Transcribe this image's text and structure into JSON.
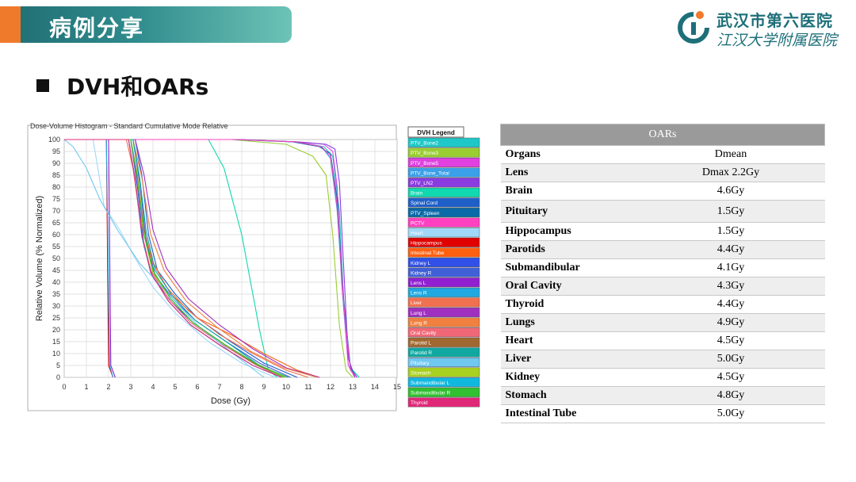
{
  "slide": {
    "banner_title": "病例分享",
    "logo_line1": "武汉市第六医院",
    "logo_line2": "江汉大学附属医院",
    "heading": "DVH和OARs"
  },
  "colors": {
    "banner_dark": "#1f6d72",
    "banner_light": "#6cc3b6",
    "accent_orange": "#f07a2b",
    "table_header": "#9a9a9a"
  },
  "icons": {
    "logo": "hospital-emblem-icon",
    "bullet": "square-bullet-icon"
  },
  "chart_data": {
    "type": "line",
    "title": "Dose-Volume Histogram - Standard Cumulative Mode Relative",
    "xlabel": "Dose (Gy)",
    "ylabel": "Relative Volume (% Normalized)",
    "xlim": [
      0,
      15
    ],
    "ylim": [
      0,
      100
    ],
    "xticks": [
      "0",
      "1",
      "2",
      "3",
      "4",
      "5",
      "6",
      "7",
      "8",
      "9",
      "10",
      "11",
      "12",
      "13",
      "14",
      "15"
    ],
    "yticks": [
      "0",
      "5",
      "10",
      "15",
      "20",
      "25",
      "30",
      "35",
      "40",
      "45",
      "50",
      "55",
      "60",
      "65",
      "70",
      "75",
      "80",
      "85",
      "90",
      "95",
      "100"
    ],
    "grid": true,
    "legend_title": "DVH Legend",
    "legend_position": "right",
    "series": [
      {
        "name": "PTV_Bone2",
        "color": "#1ec8c8",
        "x": [
          0,
          7.8,
          10.5,
          11.7,
          12.1,
          12.4,
          12.6,
          12.9,
          13.3
        ],
        "y": [
          100,
          100,
          99,
          97,
          93,
          70,
          30,
          4,
          0
        ]
      },
      {
        "name": "PTV_Bone3",
        "color": "#9acd32",
        "x": [
          0,
          7.5,
          10,
          11.2,
          11.8,
          12.1,
          12.4,
          12.7,
          13.0
        ],
        "y": [
          100,
          100,
          98,
          93,
          85,
          60,
          22,
          3,
          0
        ]
      },
      {
        "name": "PTV_Bone5",
        "color": "#e040e0",
        "x": [
          0,
          7.8,
          10.5,
          11.7,
          12.1,
          12.3,
          12.5,
          12.8,
          13.1
        ],
        "y": [
          100,
          100,
          99,
          98,
          95,
          80,
          40,
          5,
          0
        ]
      },
      {
        "name": "PTV_Bone_Total",
        "color": "#3aa0e8",
        "x": [
          0,
          7.6,
          10.5,
          11.6,
          12.0,
          12.3,
          12.6,
          12.9,
          13.2
        ],
        "y": [
          100,
          100,
          99,
          97,
          92,
          70,
          28,
          3,
          0
        ]
      },
      {
        "name": "PTV_LN2",
        "color": "#8a3ce0",
        "x": [
          0,
          7.9,
          10.6,
          11.8,
          12.2,
          12.4,
          12.6,
          12.8,
          13.1
        ],
        "y": [
          100,
          100,
          99,
          98,
          96,
          82,
          45,
          8,
          0
        ]
      },
      {
        "name": "Brain",
        "color": "#10d8b0",
        "x": [
          0,
          6.5,
          7.2,
          8.0,
          8.8,
          9.2,
          9.6
        ],
        "y": [
          100,
          100,
          88,
          60,
          20,
          3,
          0
        ]
      },
      {
        "name": "Spinal Cord",
        "color": "#1f5fc8",
        "x": [
          0,
          3.2,
          3.5,
          3.8,
          4.2,
          5.0,
          6.0,
          7.5,
          9.0,
          10.5
        ],
        "y": [
          100,
          100,
          85,
          60,
          45,
          35,
          25,
          15,
          6,
          0
        ]
      },
      {
        "name": "PTV_Spleen",
        "color": "#0a6aa8",
        "x": [
          0,
          7.6,
          10.3,
          11.5,
          12.0,
          12.3,
          12.6,
          12.9,
          13.2
        ],
        "y": [
          100,
          100,
          99,
          97,
          94,
          75,
          32,
          4,
          0
        ]
      },
      {
        "name": "PCTV",
        "color": "#ff40c0",
        "x": [
          0,
          7.7,
          10.5,
          11.6,
          12.0,
          12.3,
          12.6,
          12.9,
          13.2
        ],
        "y": [
          100,
          100,
          99,
          97,
          93,
          72,
          30,
          3,
          0
        ]
      },
      {
        "name": "Heart",
        "color": "#a0d8f8",
        "x": [
          0,
          1.3,
          1.8,
          2.5,
          3.2,
          4.0,
          5.0,
          6.5,
          8.0,
          9.5
        ],
        "y": [
          100,
          100,
          72,
          62,
          50,
          38,
          27,
          15,
          6,
          0
        ]
      },
      {
        "name": "Hippocampus",
        "color": "#e00000",
        "x": [
          0,
          1.9,
          2.0,
          2.2
        ],
        "y": [
          100,
          100,
          5,
          0
        ]
      },
      {
        "name": "Intestinal Tube",
        "color": "#ff6010",
        "x": [
          0,
          3.0,
          3.3,
          3.6,
          4.0,
          4.8,
          6.0,
          7.5,
          9.0,
          10.5,
          11.5
        ],
        "y": [
          100,
          100,
          85,
          62,
          48,
          35,
          25,
          18,
          10,
          3,
          0
        ]
      },
      {
        "name": "Kidney L",
        "color": "#3050e8",
        "x": [
          0,
          3.0,
          3.3,
          3.6,
          4.0,
          4.8,
          5.8,
          7.2,
          8.6,
          10.0
        ],
        "y": [
          100,
          100,
          80,
          55,
          42,
          32,
          23,
          14,
          6,
          0
        ]
      },
      {
        "name": "Kidney R",
        "color": "#4060d8",
        "x": [
          0,
          3.1,
          3.4,
          3.7,
          4.1,
          4.9,
          5.9,
          7.3,
          8.8,
          10.2
        ],
        "y": [
          100,
          100,
          82,
          57,
          43,
          33,
          24,
          15,
          6,
          0
        ]
      },
      {
        "name": "Lens L",
        "color": "#9020d0",
        "x": [
          0,
          2.0,
          2.1,
          2.3
        ],
        "y": [
          100,
          100,
          5,
          0
        ]
      },
      {
        "name": "Lens R",
        "color": "#20a8e0",
        "x": [
          0,
          1.9,
          2.05,
          2.2
        ],
        "y": [
          100,
          100,
          5,
          0
        ]
      },
      {
        "name": "Liver",
        "color": "#f07050",
        "x": [
          0,
          2.8,
          3.1,
          3.4,
          3.8,
          4.6,
          5.6,
          7.0,
          8.5,
          10.0,
          11.0
        ],
        "y": [
          100,
          100,
          88,
          68,
          52,
          38,
          28,
          18,
          10,
          3,
          0
        ]
      },
      {
        "name": "Lung L",
        "color": "#a030c0",
        "x": [
          0,
          3.2,
          3.6,
          4.0,
          4.6,
          5.6,
          7.0,
          8.5,
          10.0,
          11.5
        ],
        "y": [
          100,
          100,
          85,
          62,
          46,
          33,
          22,
          12,
          4,
          0
        ]
      },
      {
        "name": "Lung R",
        "color": "#f08040",
        "x": [
          0,
          3.1,
          3.5,
          3.9,
          4.5,
          5.5,
          6.9,
          8.4,
          9.9,
          11.4
        ],
        "y": [
          100,
          100,
          84,
          60,
          45,
          32,
          21,
          11,
          4,
          0
        ]
      },
      {
        "name": "Oral Cavity",
        "color": "#f06878",
        "x": [
          0,
          2.9,
          3.2,
          3.5,
          3.9,
          4.7,
          5.7,
          7.1,
          8.5,
          9.8
        ],
        "y": [
          100,
          100,
          82,
          60,
          45,
          33,
          23,
          14,
          6,
          0
        ]
      },
      {
        "name": "Parotid L",
        "color": "#a06830",
        "x": [
          0,
          3.0,
          3.3,
          3.6,
          4.0,
          4.8,
          5.8,
          7.2,
          8.7,
          10.0
        ],
        "y": [
          100,
          100,
          83,
          60,
          44,
          33,
          23,
          14,
          5,
          0
        ]
      },
      {
        "name": "Parotid R",
        "color": "#10a8a0",
        "x": [
          0,
          3.1,
          3.4,
          3.7,
          4.1,
          4.9,
          5.9,
          7.3,
          8.8,
          10.1
        ],
        "y": [
          100,
          100,
          84,
          61,
          45,
          34,
          24,
          15,
          5,
          0
        ]
      },
      {
        "name": "Pituitary",
        "color": "#70c8f0",
        "x": [
          0,
          0.4,
          1.0,
          1.6,
          2.4,
          3.4,
          4.6,
          6.0,
          7.6,
          9.0
        ],
        "y": [
          100,
          97,
          88,
          75,
          62,
          48,
          36,
          22,
          10,
          0
        ]
      },
      {
        "name": "Stomach",
        "color": "#a8d020",
        "x": [
          0,
          3.0,
          3.3,
          3.6,
          4.0,
          4.8,
          5.8,
          7.2,
          8.6,
          10.0
        ],
        "y": [
          100,
          100,
          84,
          60,
          44,
          33,
          23,
          14,
          6,
          0
        ]
      },
      {
        "name": "Submandibular L",
        "color": "#10b8e0",
        "x": [
          0,
          2.9,
          3.2,
          3.5,
          3.9,
          4.7,
          5.7,
          7.1,
          8.5,
          9.8
        ],
        "y": [
          100,
          100,
          83,
          59,
          44,
          32,
          22,
          13,
          5,
          0
        ]
      },
      {
        "name": "Submandibular R",
        "color": "#30c030",
        "x": [
          0,
          3.0,
          3.3,
          3.6,
          4.0,
          4.8,
          5.8,
          7.2,
          8.6,
          9.9
        ],
        "y": [
          100,
          100,
          84,
          60,
          45,
          33,
          23,
          14,
          6,
          0
        ]
      },
      {
        "name": "Thyroid",
        "color": "#e02878",
        "x": [
          0,
          2.9,
          3.2,
          3.5,
          3.9,
          4.7,
          5.7,
          7.1,
          8.5,
          9.8
        ],
        "y": [
          100,
          100,
          83,
          60,
          44,
          32,
          22,
          13,
          5,
          0
        ]
      }
    ]
  },
  "oars_table": {
    "title": "OARs",
    "rows": [
      {
        "organ": "Organs",
        "value": "Dmean"
      },
      {
        "organ": "Lens",
        "value": "Dmax 2.2Gy"
      },
      {
        "organ": "Brain",
        "value": "4.6Gy"
      },
      {
        "organ": "Pituitary",
        "value": "1.5Gy"
      },
      {
        "organ": "Hippocampus",
        "value": "1.5Gy"
      },
      {
        "organ": "Parotids",
        "value": "4.4Gy"
      },
      {
        "organ": "Submandibular",
        "value": "4.1Gy"
      },
      {
        "organ": "Oral Cavity",
        "value": "4.3Gy"
      },
      {
        "organ": "Thyroid",
        "value": "4.4Gy"
      },
      {
        "organ": "Lungs",
        "value": "4.9Gy"
      },
      {
        "organ": "Heart",
        "value": "4.5Gy"
      },
      {
        "organ": "Liver",
        "value": "5.0Gy"
      },
      {
        "organ": "Kidney",
        "value": "4.5Gy"
      },
      {
        "organ": "Stomach",
        "value": "4.8Gy"
      },
      {
        "organ": "Intestinal Tube",
        "value": "5.0Gy"
      }
    ]
  }
}
